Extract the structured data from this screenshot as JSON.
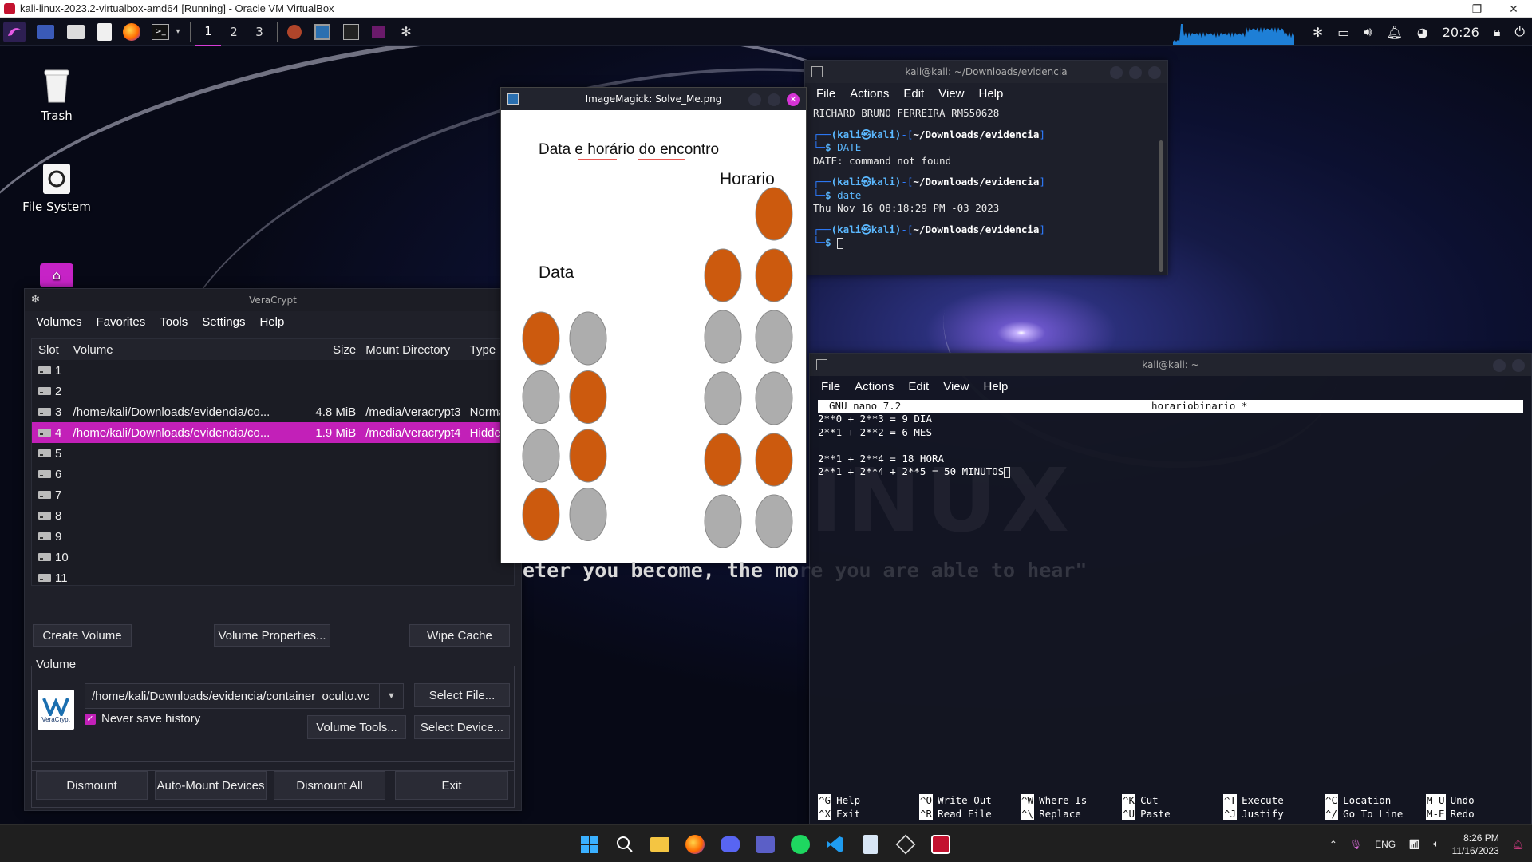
{
  "host": {
    "title": "kali-linux-2023.2-virtualbox-amd64 [Running] - Oracle VM VirtualBox",
    "controls": [
      "—",
      "❐",
      "✕"
    ]
  },
  "panel": {
    "workspaces": [
      "1",
      "2",
      "3"
    ],
    "clock": "20:26"
  },
  "desktop_icons": [
    {
      "label": "Trash"
    },
    {
      "label": "File System"
    }
  ],
  "imagemagick": {
    "title": "ImageMagick: Solve_Me.png",
    "heading": "Data e horário do encontro",
    "label_horario": "Horario",
    "label_data": "Data",
    "dot_orange": "#cc5a0e",
    "dot_gray": "#adadad",
    "data_grid": [
      [
        "on",
        "off"
      ],
      [
        "off",
        "on"
      ],
      [
        "off",
        "on"
      ],
      [
        "on",
        "off"
      ]
    ],
    "horario_grid": [
      [
        "none",
        "on"
      ],
      [
        "on",
        "on"
      ],
      [
        "off",
        "off"
      ],
      [
        "off",
        "off"
      ],
      [
        "on",
        "on"
      ],
      [
        "off",
        "off"
      ]
    ]
  },
  "term1": {
    "title": "kali@kali: ~/Downloads/evidencia",
    "menu": [
      "File",
      "Actions",
      "Edit",
      "View",
      "Help"
    ],
    "line1": "RICHARD BRUNO FERREIRA RM550628",
    "prompt_user": "(kali㉿kali)",
    "prompt_path": "~/Downloads/evidencia",
    "cmd1": "DATE",
    "out1": "DATE: command not found",
    "cmd2": "date",
    "out2": "Thu Nov 16 08:18:29 PM -03 2023"
  },
  "term2": {
    "title": "kali@kali: ~",
    "menu": [
      "File",
      "Actions",
      "Edit",
      "View",
      "Help"
    ],
    "nano_version": "GNU nano 7.2",
    "nano_file": "horariobinario *",
    "lines": [
      "2**0 + 2**3 = 9 DIA",
      "2**1 + 2**2 = 6 MES",
      "",
      "2**1 + 2**4 = 18 HORA",
      "2**1 + 2**4 + 2**5 = 50 MINUTOS"
    ],
    "watermark": "INUX",
    "quote_visible": "eter you become, the mo",
    "quote_dim": "re you are able to hear\"",
    "shortcuts": [
      {
        "k1": "^G",
        "l1": "Help",
        "k2": "^X",
        "l2": "Exit"
      },
      {
        "k1": "^O",
        "l1": "Write Out",
        "k2": "^R",
        "l2": "Read File"
      },
      {
        "k1": "^W",
        "l1": "Where Is",
        "k2": "^\\",
        "l2": "Replace"
      },
      {
        "k1": "^K",
        "l1": "Cut",
        "k2": "^U",
        "l2": "Paste"
      },
      {
        "k1": "^T",
        "l1": "Execute",
        "k2": "^J",
        "l2": "Justify"
      },
      {
        "k1": "^C",
        "l1": "Location",
        "k2": "^/",
        "l2": "Go To Line"
      },
      {
        "k1": "M-U",
        "l1": "Undo",
        "k2": "M-E",
        "l2": "Redo"
      }
    ]
  },
  "veracrypt": {
    "title": "VeraCrypt",
    "menu": [
      "Volumes",
      "Favorites",
      "Tools",
      "Settings",
      "Help"
    ],
    "columns": [
      "Slot",
      "Volume",
      "Size",
      "Mount Directory",
      "Type"
    ],
    "rows": [
      {
        "slot": "1",
        "volume": "",
        "size": "",
        "mount": "",
        "type": ""
      },
      {
        "slot": "2",
        "volume": "",
        "size": "",
        "mount": "",
        "type": ""
      },
      {
        "slot": "3",
        "volume": "/home/kali/Downloads/evidencia/co...",
        "size": "4.8 MiB",
        "mount": "/media/veracrypt3",
        "type": "Normal"
      },
      {
        "slot": "4",
        "volume": "/home/kali/Downloads/evidencia/co...",
        "size": "1.9 MiB",
        "mount": "/media/veracrypt4",
        "type": "Hidden",
        "selected": true
      },
      {
        "slot": "5",
        "volume": "",
        "size": "",
        "mount": "",
        "type": ""
      },
      {
        "slot": "6",
        "volume": "",
        "size": "",
        "mount": "",
        "type": ""
      },
      {
        "slot": "7",
        "volume": "",
        "size": "",
        "mount": "",
        "type": ""
      },
      {
        "slot": "8",
        "volume": "",
        "size": "",
        "mount": "",
        "type": ""
      },
      {
        "slot": "9",
        "volume": "",
        "size": "",
        "mount": "",
        "type": ""
      },
      {
        "slot": "10",
        "volume": "",
        "size": "",
        "mount": "",
        "type": ""
      },
      {
        "slot": "11",
        "volume": "",
        "size": "",
        "mount": "",
        "type": ""
      }
    ],
    "btn_create": "Create Volume",
    "btn_props": "Volume Properties...",
    "btn_wipe": "Wipe Cache",
    "volume_label": "Volume",
    "volume_path": "/home/kali/Downloads/evidencia/container_oculto.vc",
    "never_save": "Never save history",
    "btn_select_file": "Select File...",
    "btn_tools": "Volume Tools...",
    "btn_select_device": "Select Device...",
    "btn_dismount": "Dismount",
    "btn_automount": "Auto-Mount Devices",
    "btn_dismount_all": "Dismount All",
    "btn_exit": "Exit",
    "logo_text": "VeraCrypt"
  },
  "taskbar": {
    "lang": "ENG",
    "time": "8:26 PM",
    "date": "11/16/2023"
  }
}
